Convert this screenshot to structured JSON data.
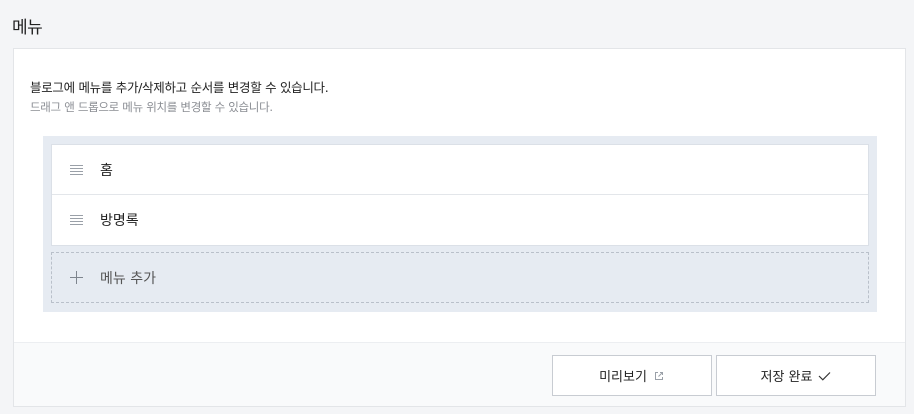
{
  "page": {
    "title": "메뉴"
  },
  "description": {
    "main": "블로그에 메뉴를 추가/삭제하고 순서를 변경할 수 있습니다.",
    "sub": "드래그 앤 드롭으로 메뉴 위치를 변경할 수 있습니다."
  },
  "menu": {
    "items": [
      {
        "label": "홈",
        "icon": "drag-handle-icon"
      },
      {
        "label": "방명록",
        "icon": "drag-handle-icon"
      }
    ],
    "add_label": "메뉴 추가",
    "add_icon": "plus-icon"
  },
  "footer": {
    "preview_label": "미리보기",
    "preview_icon": "external-link-icon",
    "save_label": "저장 완료",
    "save_icon": "check-icon"
  }
}
